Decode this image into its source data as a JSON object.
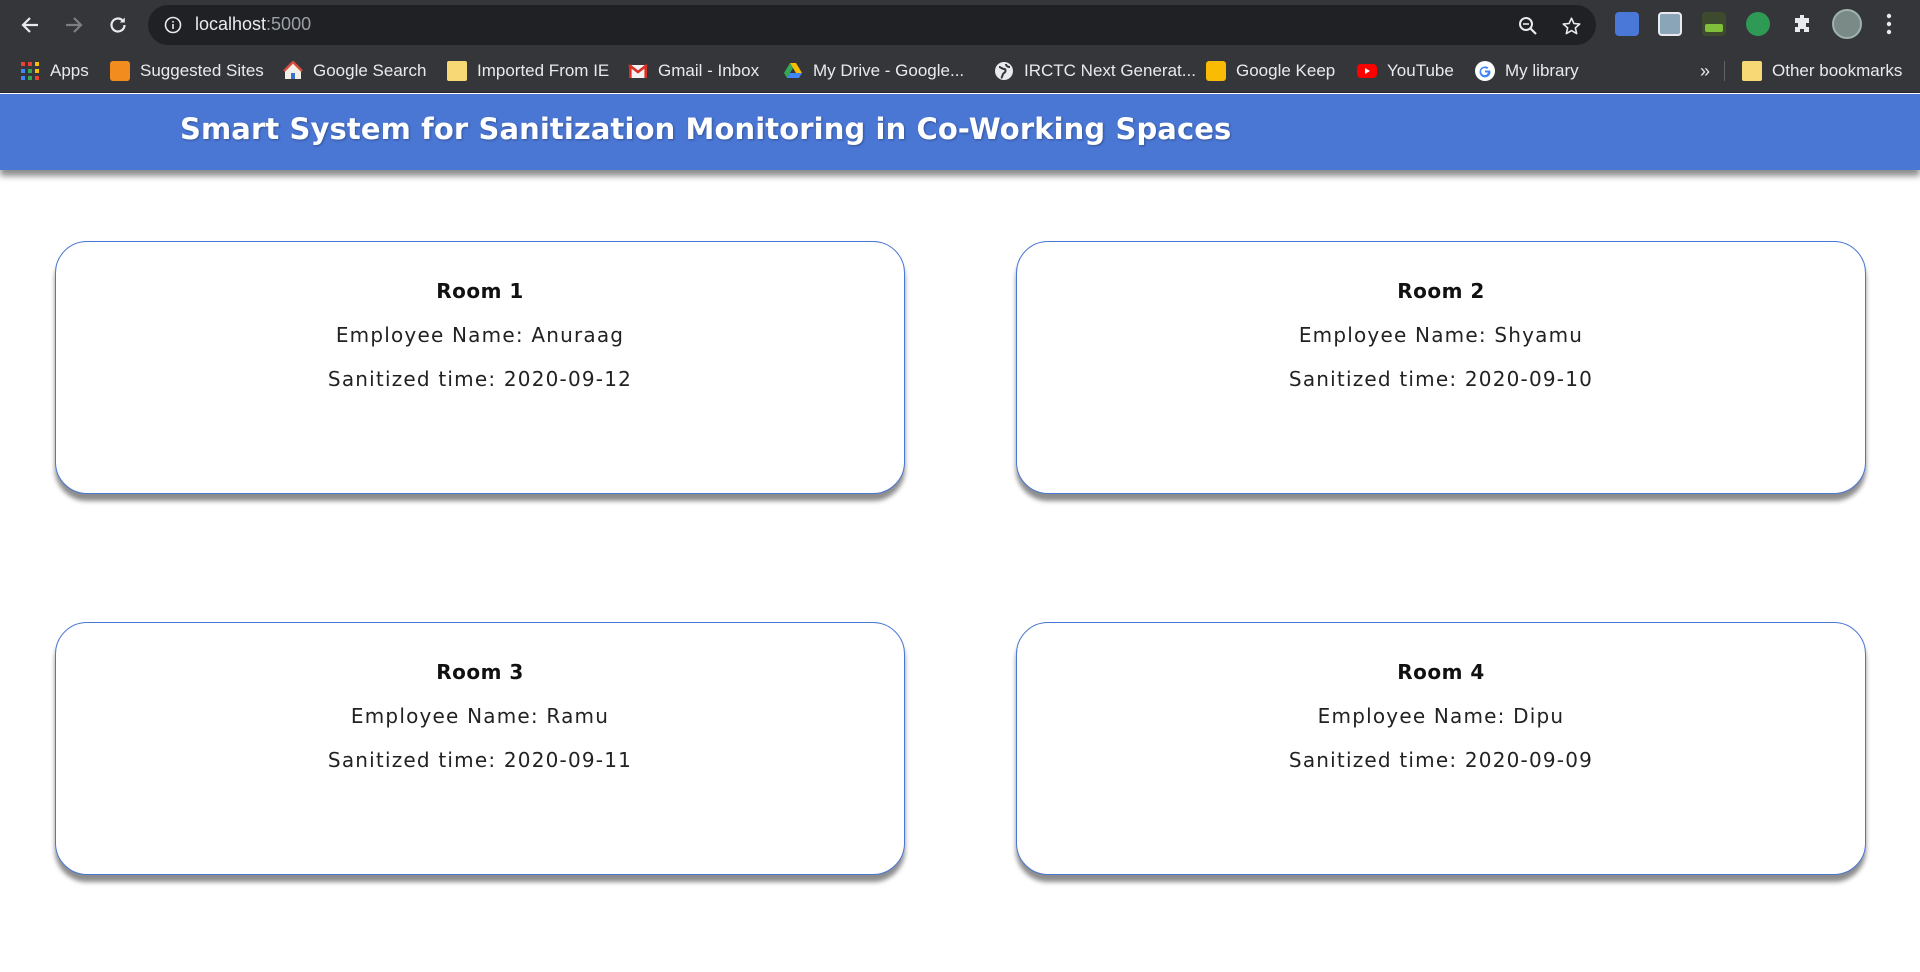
{
  "browser": {
    "url_host": "localhost",
    "url_port": ":5000",
    "bookmarks": [
      {
        "label": "Apps",
        "icon": "apps-grid-icon"
      },
      {
        "label": "Suggested Sites",
        "icon": "suggested-sites-icon"
      },
      {
        "label": "Google Search",
        "icon": "google-search-house-icon"
      },
      {
        "label": "Imported From IE",
        "icon": "folder-icon"
      },
      {
        "label": "Gmail - Inbox",
        "icon": "gmail-icon"
      },
      {
        "label": "My Drive - Google...",
        "icon": "google-drive-icon"
      },
      {
        "label": "IRCTC Next Generat...",
        "icon": "globe-icon"
      },
      {
        "label": "Google Keep",
        "icon": "google-keep-icon"
      },
      {
        "label": "YouTube",
        "icon": "youtube-icon"
      },
      {
        "label": "My library",
        "icon": "google-g-icon"
      }
    ],
    "overflow_label": "»",
    "other_bookmarks": "Other bookmarks"
  },
  "page": {
    "title": "Smart System for Sanitization Monitoring in Co-Working Spaces",
    "colors": {
      "header": "#4a76d4",
      "card_border": "#4a76d4"
    },
    "rooms": [
      {
        "title": "Room 1",
        "employee": "Employee Name: Anuraag",
        "time": "Sanitized time: 2020-09-12"
      },
      {
        "title": "Room 2",
        "employee": "Employee Name: Shyamu",
        "time": "Sanitized time: 2020-09-10"
      },
      {
        "title": "Room 3",
        "employee": "Employee Name: Ramu",
        "time": "Sanitized time: 2020-09-11"
      },
      {
        "title": "Room 4",
        "employee": "Employee Name: Dipu",
        "time": "Sanitized time: 2020-09-09"
      }
    ]
  }
}
